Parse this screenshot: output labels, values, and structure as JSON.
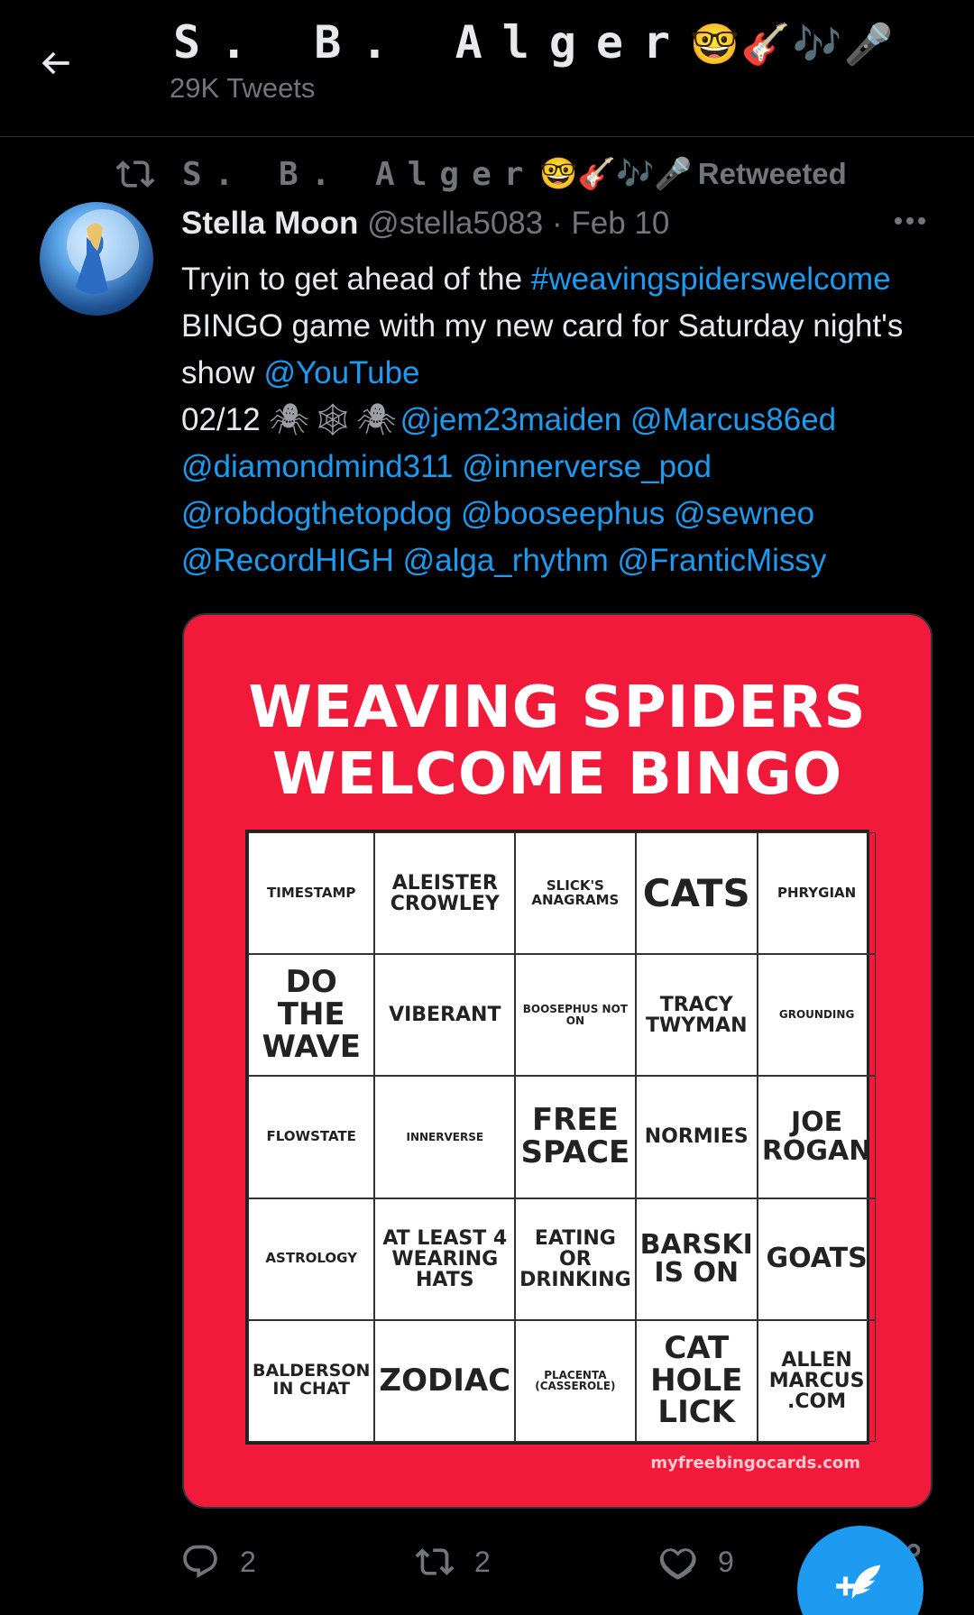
{
  "header": {
    "name": "S. B. Alger",
    "name_emoji": "🤓🎸🎶🎤",
    "tweet_count": "29K Tweets"
  },
  "retweet": {
    "name": "S. B. Alger",
    "emoji": "🤓🎸🎶🎤",
    "label": "Retweeted"
  },
  "tweet": {
    "author": "Stella Moon",
    "handle": "@stella5083",
    "separator": "·",
    "date": "Feb 10",
    "text_1": "Tryin to get ahead of the",
    "hashtag": "#weavingspiderswelcome",
    "text_2": " BINGO game with my new card for Saturday night's show ",
    "mention_youtube": "@YouTube",
    "text_3": "02/12 ",
    "emojis": "🕷🕸🕷",
    "mentions": [
      "@jem23maiden",
      "@Marcus86ed",
      "@diamondmind311",
      "@innerverse_pod",
      "@robdogthetopdog",
      "@booseephus",
      "@sewneo",
      "@RecordHIGH",
      "@alga_rhythm",
      "@FranticMissy"
    ]
  },
  "media": {
    "title_line1": "WEAVING SPIDERS",
    "title_line2": "WELCOME BINGO",
    "credit": "myfreebingocards.com",
    "cells": [
      "TIMESTAMP",
      "ALEISTER CROWLEY",
      "SLICK'S ANAGRAMS",
      "CATS",
      "PHRYGIAN",
      "DO THE WAVE",
      "VIBERANT",
      "BOOSEPHUS NOT ON",
      "TRACY TWYMAN",
      "GROUNDING",
      "FLOWSTATE",
      "INNERVERSE",
      "FREE SPACE",
      "NORMIES",
      "JOE ROGAN",
      "ASTROLOGY",
      "AT LEAST 4 WEARING HATS",
      "EATING OR DRINKING",
      "BARSKI IS ON",
      "GOATS",
      "BALDERSON IN CHAT",
      "ZODIAC",
      "PLACENTA (CASSEROLE)",
      "CAT HOLE LICK",
      "ALLEN MARCUS .COM"
    ]
  },
  "actions": {
    "reply_count": "2",
    "retweet_count": "2",
    "like_count": "9"
  },
  "colors": {
    "background": "#000000",
    "link": "#1d9bf0",
    "muted": "#71767b",
    "card_red": "#f11a3a"
  }
}
